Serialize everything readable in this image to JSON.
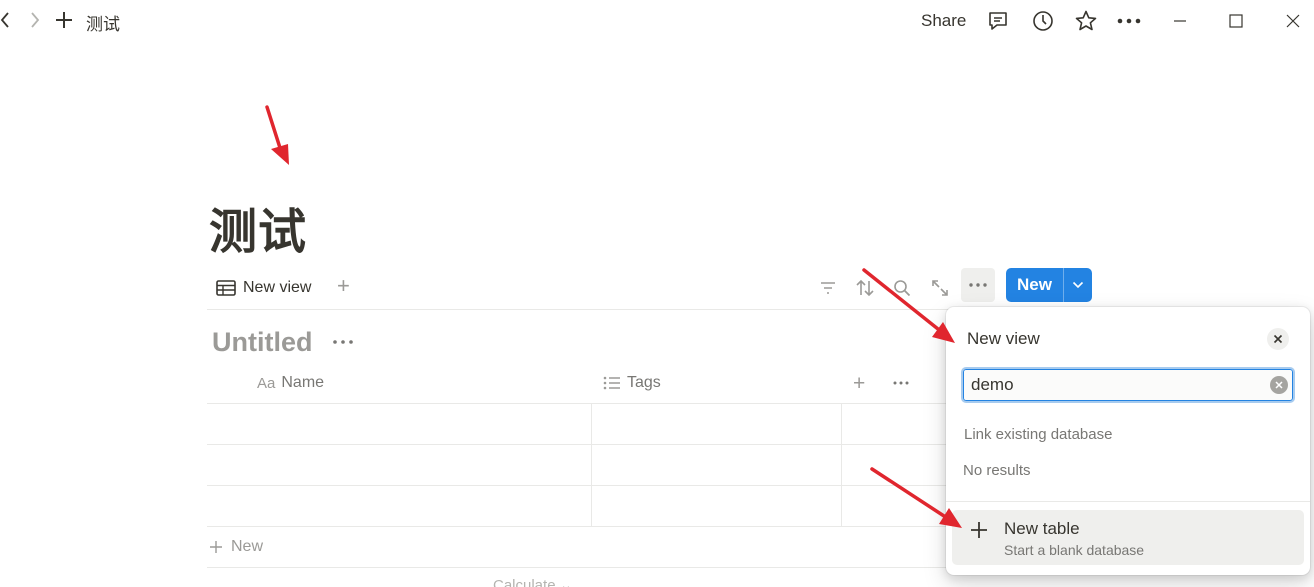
{
  "topbar": {
    "page_title": "测试",
    "share_label": "Share"
  },
  "page": {
    "title": "测试"
  },
  "view": {
    "tab_label": "New view",
    "new_button_label": "New"
  },
  "database": {
    "title": "Untitled",
    "columns": [
      {
        "label": "Name",
        "icon": "text-aa-icon"
      },
      {
        "label": "Tags",
        "icon": "list-icon"
      }
    ],
    "type_glyph": "Aa",
    "rows": 3,
    "add_row_label": "New",
    "calculate_label": "Calculate"
  },
  "popup": {
    "title": "New view",
    "search_value": "demo",
    "section_label": "Link existing database",
    "empty_label": "No results",
    "item_label": "New table",
    "item_description": "Start a blank database"
  },
  "colors": {
    "accent": "#2383e2",
    "annotation_arrow": "#e0262e",
    "text": "#37352f",
    "muted": "#9b9a97"
  }
}
